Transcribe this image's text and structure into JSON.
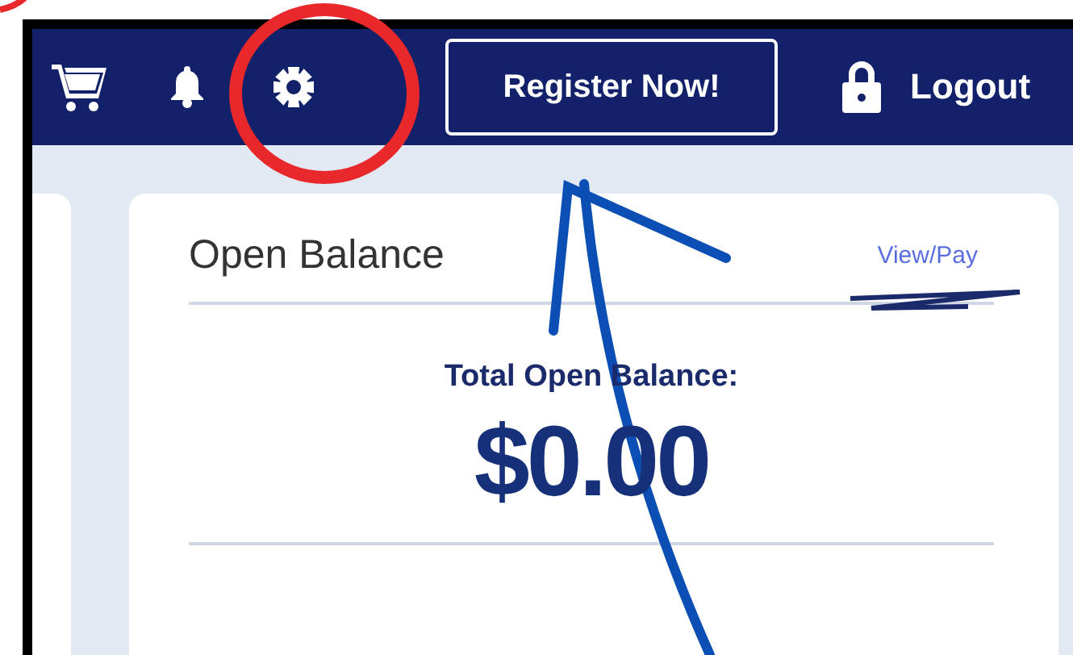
{
  "header": {
    "register_button": "Register Now!",
    "logout": "Logout"
  },
  "balance_card": {
    "title": "Open Balance",
    "link": "View/Pay",
    "total_label": "Total Open Balance:",
    "total": "$0.00"
  }
}
